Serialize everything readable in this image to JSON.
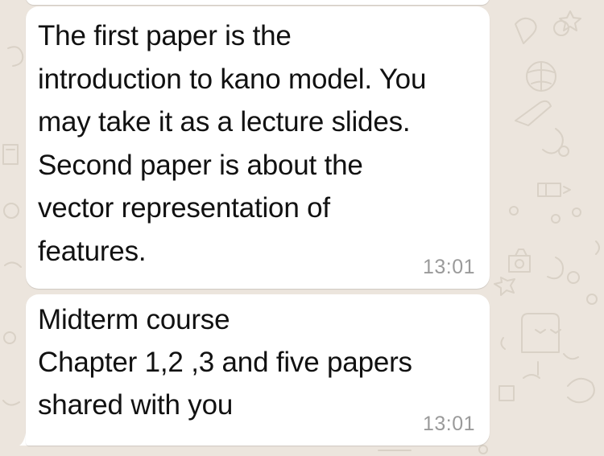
{
  "chat": {
    "messages": [
      {
        "text": "The first paper is the\nintroduction to kano model. You\nmay take it as a lecture slides.\nSecond paper is about the\nvector representation of\nfeatures.",
        "time": "13:01"
      },
      {
        "text": "Midterm course\nChapter 1,2 ,3 and five papers\nshared with you",
        "time": "13:01"
      }
    ]
  },
  "colors": {
    "wallpaper": "#ece5dd",
    "bubble": "#ffffff",
    "text": "#111111",
    "timestamp": "#9a9a9a"
  }
}
